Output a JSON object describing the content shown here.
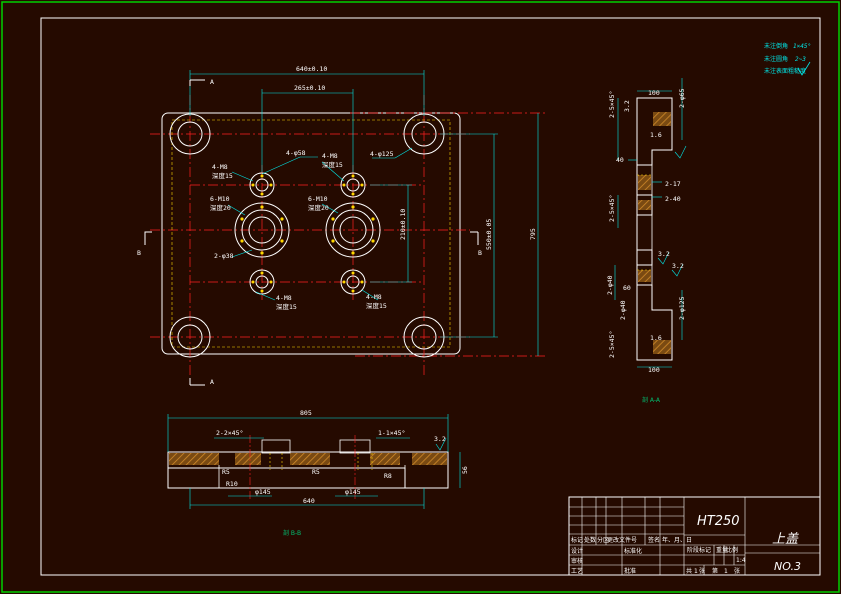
{
  "colors": {
    "background": "#000000",
    "sheet": "#250a00",
    "frame_outer": "#00d000",
    "outline": "#ffffff",
    "centerline": "#ff2020",
    "dimension": "#00e6e6",
    "hidden": "#ffd700",
    "hatch": "#c07a1a",
    "section_label": "#00c070"
  },
  "notes": {
    "line1_label": "未注倒角",
    "line1_value": "1×45°",
    "line2_label": "未注圆角",
    "line2_value": "2~3",
    "line3_label": "未注表面粗糙度"
  },
  "plan_view": {
    "dim_overall_width": "640±0.10",
    "dim_inner_width": "265±0.10",
    "dim_inner_height": "210±0.10",
    "dim_outer_height": "550±0.05",
    "dim_total_height": "795",
    "label_4_d58": "4-φ58",
    "label_4_d125": "4-φ125",
    "label_4_m8_tl": "4-M8",
    "label_4_m8_tl_sub": "深度15",
    "label_4_m8_tr": "4-M8",
    "label_4_m8_tr_sub": "深度15",
    "label_6_m10_l": "6-M10",
    "label_6_m10_l_sub": "深度20",
    "label_6_m10_r": "6-M10",
    "label_6_m10_r_sub": "深度20",
    "label_2_d38": "2-φ38",
    "label_4_m8_bl": "4-M8",
    "label_4_m8_bl_sub": "深度15",
    "label_4_m8_br": "4-M8",
    "label_4_m8_br_sub": "深度15",
    "cut_a_top": "A",
    "cut_a_bottom": "A",
    "cut_b_left": "B",
    "cut_b_right": "B"
  },
  "section_a": {
    "title": "剖 A-A",
    "dim_top_100": "100",
    "dim_bottom_100": "100",
    "dim_2_45_a": "2-5×45°",
    "dim_2_45_b": "2-5×45°",
    "dim_2_45_c": "2-5×45°",
    "dim_2_d65": "2-φ65",
    "dim_2_d40": "2-φ40",
    "dim_2_d40b": "2-φ40",
    "dim_2_17": "2-17",
    "dim_2_40": "2-40",
    "dim_2_d125": "2-φ125",
    "dim_40": "40",
    "dim_60": "60",
    "dim_32": "3.2",
    "dim_16a": "1.6",
    "dim_16b": "1.6",
    "rough_a": "3.2",
    "rough_b": "3.2"
  },
  "section_b": {
    "title": "剖 B-B",
    "dim_805": "805",
    "dim_640": "640",
    "dim_2_2x45": "2-2×45°",
    "dim_1_1x45": "1-1×45°",
    "dim_d145_l": "φ145",
    "dim_d145_r": "φ145",
    "dim_r5_l": "R5",
    "dim_r10": "R10",
    "dim_r5_r": "R5",
    "dim_r8": "R8",
    "dim_56": "56",
    "rough": "3.2"
  },
  "title_block": {
    "material": "HT250",
    "part_name": "上盖",
    "drawing_no": "NO.3",
    "scale": "1:4",
    "h_mark": "标记",
    "h_count": "处数",
    "h_zone": "分区",
    "h_change_doc": "更改文件号",
    "h_sign": "签名",
    "h_date": "年、月、日",
    "r_designer": "设计",
    "r_standard": "标准化",
    "r_checker": "审核",
    "r_process": "工艺",
    "r_approve": "批准",
    "stage_mark": "阶段标记",
    "weight": "重量",
    "ratio": "比例",
    "sheet_total": "共",
    "sheet_total_n": "1",
    "sheet_no": "张",
    "sheet_cur": "第",
    "sheet_cur_n": "1",
    "sheet_cur_unit": "张"
  }
}
